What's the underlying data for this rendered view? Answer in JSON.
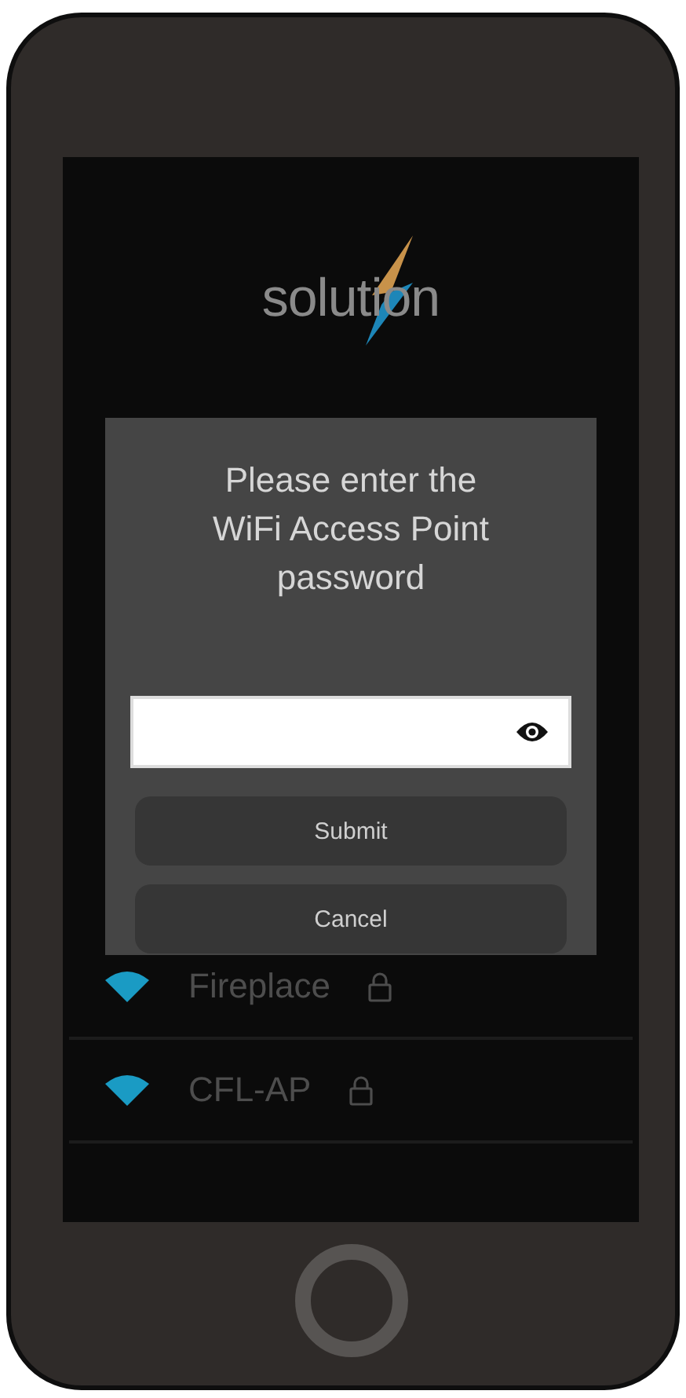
{
  "logo": {
    "text": "solution"
  },
  "dialog": {
    "title": "Please enter the WiFi Access Point password",
    "buttons": [
      "Submit",
      "Cancel"
    ]
  },
  "networks": [
    {
      "name": "Fireplace",
      "locked": true
    },
    {
      "name": "CFL-AP",
      "locked": true
    }
  ]
}
